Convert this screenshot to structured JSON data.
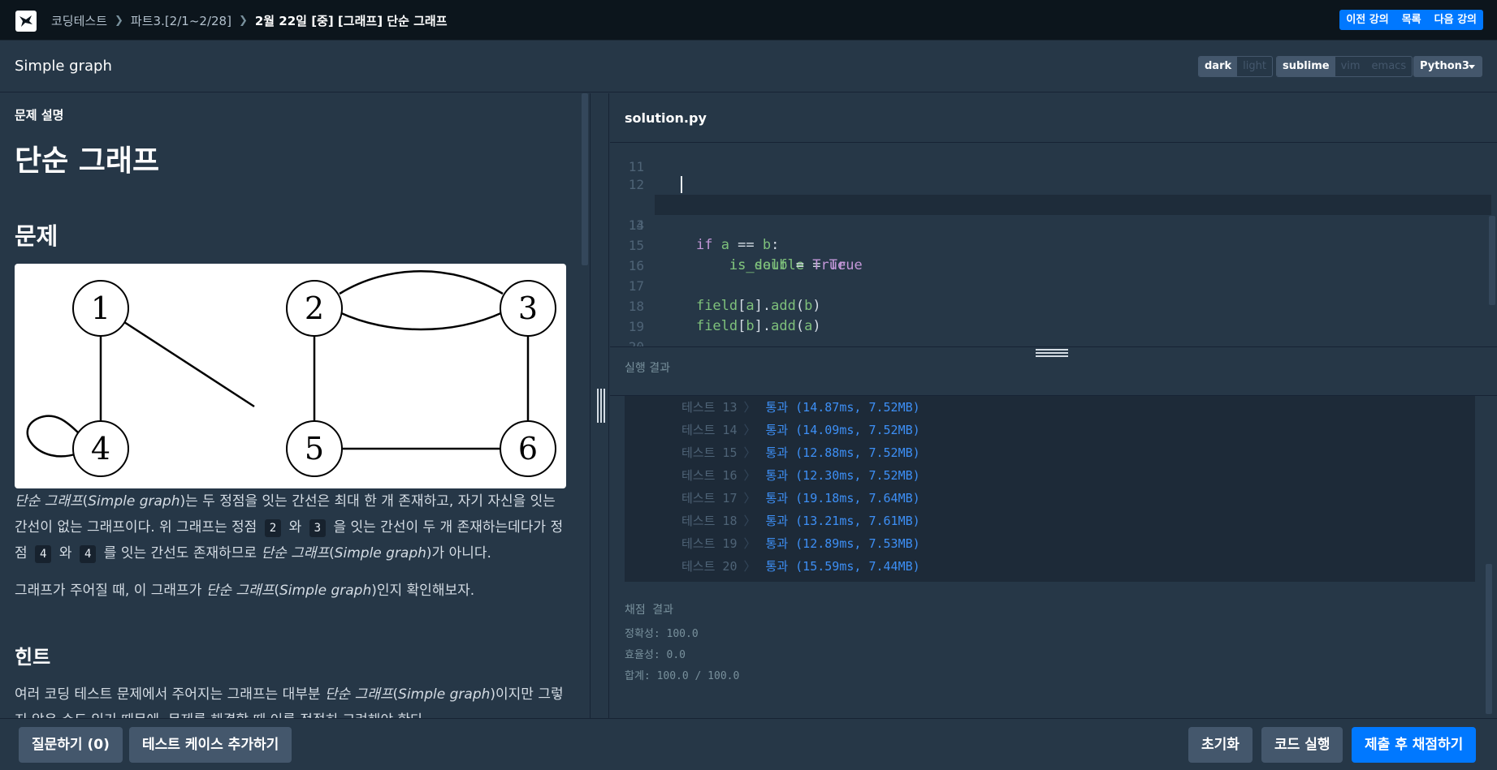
{
  "nav": {
    "breadcrumbs": [
      "코딩테스트",
      "파트3.[2/1~2/28]",
      "2월 22일 [중] [그래프] 단순 그래프"
    ],
    "prev_label": "이전 강의",
    "list_label": "목록",
    "next_label": "다음 강의"
  },
  "titlebar": {
    "lesson_title": "Simple graph",
    "theme_options": [
      "dark",
      "light"
    ],
    "theme_selected": "dark",
    "keymap_options": [
      "sublime",
      "vim",
      "emacs"
    ],
    "keymap_selected": "sublime",
    "language": "Python3"
  },
  "problem": {
    "section_label": "문제 설명",
    "title": "단순 그래프",
    "heading_problem": "문제",
    "graph_nodes": [
      "1",
      "2",
      "3",
      "4",
      "5",
      "6"
    ],
    "p1": {
      "a": "단순 그래프",
      "b": "(",
      "c": "Simple graph",
      "d": ")는 두 정점을 잇는 간선은 최대 한 개 존재하고, 자기 자신을 잇는 간선이 없는 그래프이다. 위 그래프는 정점",
      "chip1": "2",
      "e": "와",
      "chip2": "3",
      "f": "을 잇는 간선이 두 개 존재하는데다가 정점",
      "chip3": "4",
      "g": "와",
      "chip4": "4",
      "h": "를 잇는 간선도 존재하므로",
      "i": "단순 그래프",
      "j": "(",
      "k": "Simple graph",
      "l": ")가 아니다."
    },
    "p2": {
      "a": "그래프가 주어질 때, 이 그래프가",
      "b": "단순 그래프",
      "c": "(",
      "d": "Simple graph",
      "e": ")인지 확인해보자."
    },
    "heading_hint": "힌트",
    "p3": {
      "a": "여러 코딩 테스트 문제에서 주어지는 그래프는 대부분",
      "b": "단순 그래프",
      "c": "(",
      "d": "Simple graph",
      "e": ")이지만 그렇지 않은 수도 있기 때문에, 문제를 해결할 때 이를 적절히 고려해야 한다."
    }
  },
  "editor": {
    "file_name": "solution.py",
    "line_numbers": [
      "11",
      "12",
      "13",
      "14",
      "15",
      "16",
      "17",
      "18",
      "19",
      "20"
    ],
    "active_line": "13"
  },
  "results": {
    "title": "실행 결과",
    "rows": [
      {
        "name": "테스트 13",
        "value": "통과 (14.87ms, 7.52MB)"
      },
      {
        "name": "테스트 14",
        "value": "통과 (14.09ms, 7.52MB)"
      },
      {
        "name": "테스트 15",
        "value": "통과 (12.88ms, 7.52MB)"
      },
      {
        "name": "테스트 16",
        "value": "통과 (12.30ms, 7.52MB)"
      },
      {
        "name": "테스트 17",
        "value": "통과 (19.18ms, 7.64MB)"
      },
      {
        "name": "테스트 18",
        "value": "통과 (13.21ms, 7.61MB)"
      },
      {
        "name": "테스트 19",
        "value": "통과 (12.89ms, 7.53MB)"
      },
      {
        "name": "테스트 20",
        "value": "통과 (15.59ms, 7.44MB)"
      }
    ],
    "grade_title": "채점 결과",
    "accuracy": "정확성: 100.0",
    "efficiency": "효율성: 0.0",
    "total": "합계: 100.0 / 100.0"
  },
  "footer": {
    "question_btn": "질문하기 (0)",
    "add_testcase_btn": "테스트 케이스 추가하기",
    "reset_btn": "초기화",
    "run_btn": "코드 실행",
    "submit_btn": "제출 후 채점하기"
  },
  "colors": {
    "accent": "#0078ff",
    "pass": "#3d8ff5",
    "background": "#263747"
  }
}
